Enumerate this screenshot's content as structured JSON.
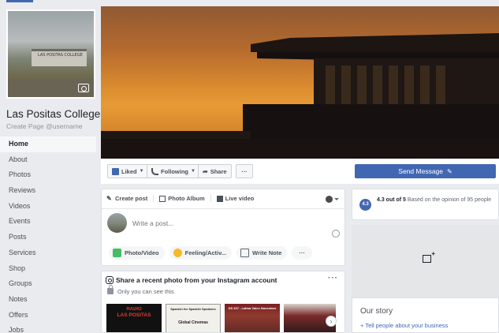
{
  "profile": {
    "page_name": "Las Positas College",
    "username_prompt": "Create Page @username",
    "sign_text": "LAS POSITAS COLLEGE"
  },
  "nav": {
    "items": [
      "Home",
      "About",
      "Photos",
      "Reviews",
      "Videos",
      "Events",
      "Posts",
      "Services",
      "Shop",
      "Groups",
      "Notes",
      "Offers",
      "Jobs"
    ],
    "active": "Home"
  },
  "action_bar": {
    "liked_label": "Liked",
    "following_label": "Following",
    "share_label": "Share",
    "more_label": "···",
    "send_message_label": "Send Message"
  },
  "composer": {
    "tabs": [
      "Create post",
      "Photo Album",
      "Live video"
    ],
    "placeholder": "Write a post...",
    "actions": [
      "Photo/Video",
      "Feeling/Activ...",
      "Write Note",
      "···"
    ]
  },
  "instagram": {
    "title": "Share a recent photo from your Instagram account",
    "subtitle": "Only you can see this",
    "more": "···",
    "next": "›",
    "thumbs": [
      {
        "line1": "RADIO",
        "line2": "LAS POSITAS"
      },
      {
        "line1": "Spanish for Spanish Speakers",
        "line2": "Global Cinemas"
      },
      {
        "line1": "DS 207 - Latina Voice November",
        "line2": ""
      },
      {
        "line1": "",
        "line2": ""
      }
    ]
  },
  "rating": {
    "badge": "4.3",
    "score_text": "4.3 out of 5",
    "basis_text": "Based on the opinion of 95 people"
  },
  "story": {
    "title": "Our story",
    "link": "+ Tell people about your business"
  },
  "colors": {
    "brand": "#4267b2",
    "background": "#e9ebee",
    "sunset_top": "#8f5a33",
    "sunset_mid": "#e89a36"
  }
}
